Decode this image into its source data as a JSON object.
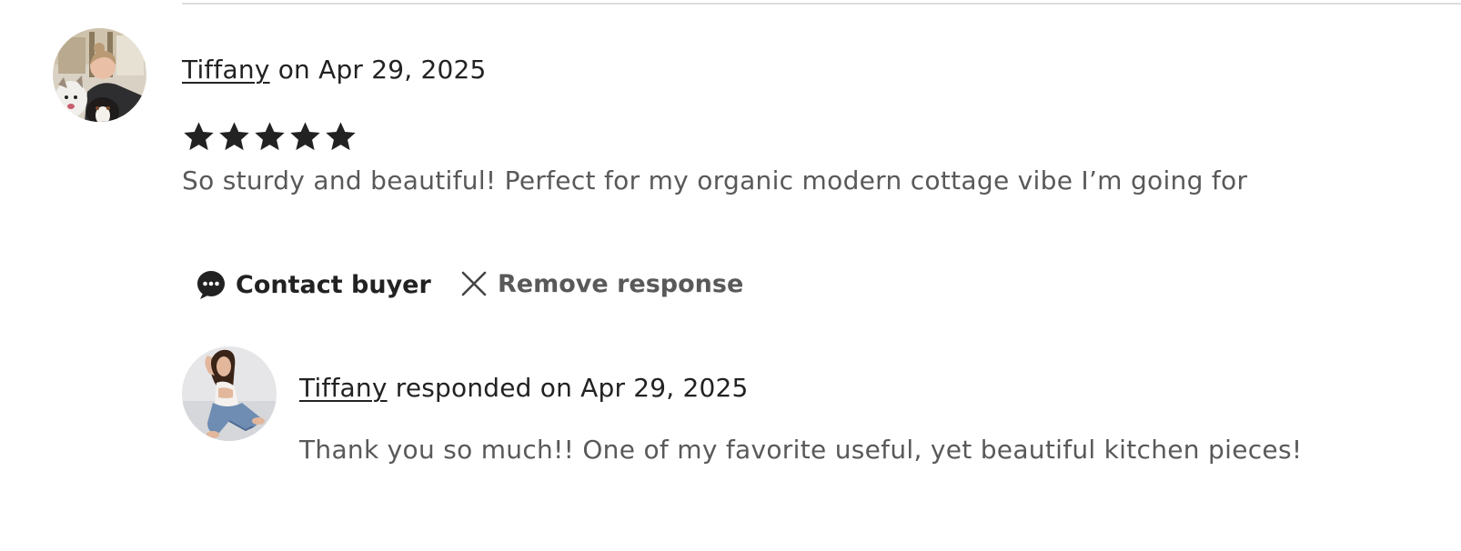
{
  "review": {
    "reviewer_name": "Tiffany",
    "date_text": " on Apr 29, 2025",
    "rating": 5,
    "rating_max": 5,
    "text": "So sturdy and beautiful! Perfect for my organic modern cottage vibe I’m going for"
  },
  "actions": {
    "contact_label": "Contact buyer",
    "contact_icon": "chat-bubble-icon",
    "remove_label": "Remove response",
    "remove_icon": "close-icon"
  },
  "response": {
    "responder_name": "Tiffany",
    "date_text": " responded on Apr 29, 2025",
    "text": "Thank you so much!! One of my favorite useful, yet beautiful kitchen pieces!"
  },
  "colors": {
    "primary_text": "#222222",
    "secondary_text": "#595959",
    "divider": "#dcdcdc"
  }
}
